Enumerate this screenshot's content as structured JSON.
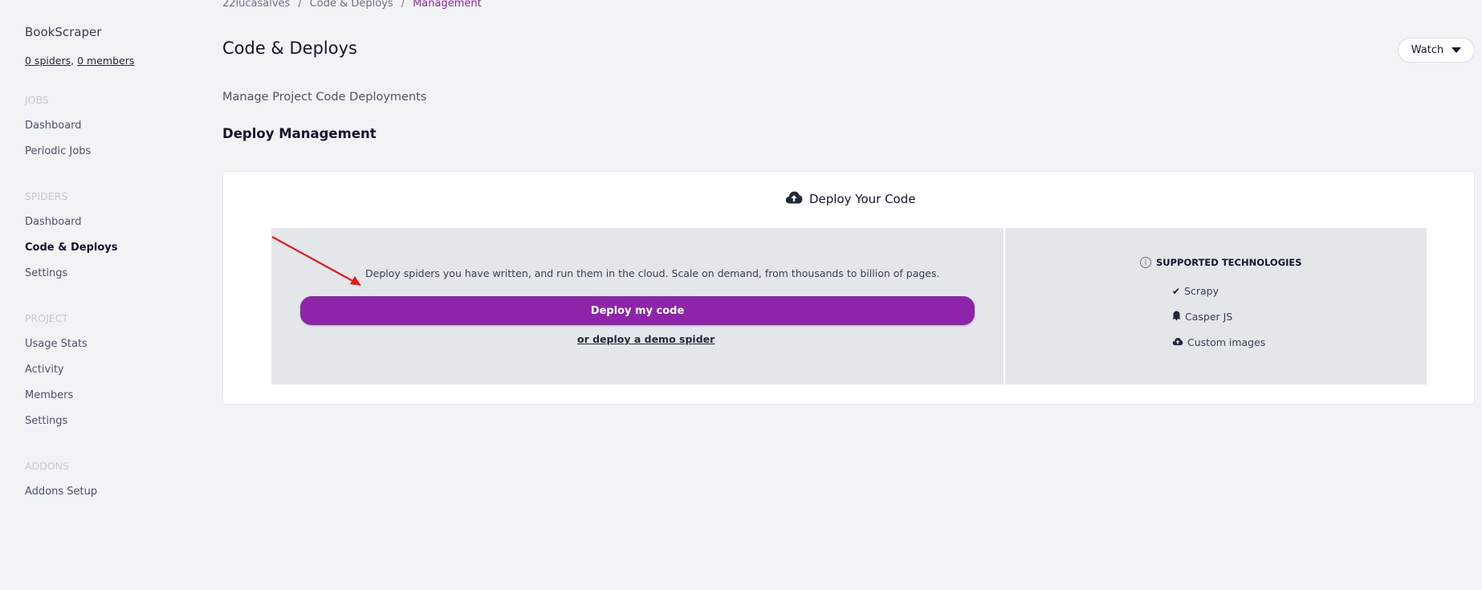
{
  "sidebar": {
    "project_name": "BookScraper",
    "spiders_link": "0 spiders",
    "separator": ",",
    "members_link": "0 members",
    "sections": {
      "jobs": {
        "title": "JOBS",
        "items": [
          "Dashboard",
          "Periodic Jobs"
        ]
      },
      "spiders": {
        "title": "SPIDERS",
        "items": [
          "Dashboard",
          "Code & Deploys",
          "Settings"
        ]
      },
      "project": {
        "title": "PROJECT",
        "items": [
          "Usage Stats",
          "Activity",
          "Members",
          "Settings"
        ]
      },
      "addons": {
        "title": "ADDONS",
        "items": [
          "Addons Setup"
        ]
      }
    }
  },
  "breadcrumb": {
    "items": [
      "22lucasalves",
      "Code & Deploys",
      "Management"
    ],
    "separator": "/"
  },
  "header": {
    "title": "Code & Deploys",
    "watch_label": "Watch"
  },
  "main": {
    "subtitle": "Manage Project Code Deployments",
    "section_heading": "Deploy Management",
    "card": {
      "title": "Deploy Your Code",
      "description": "Deploy spiders you have written, and run them in the cloud. Scale on demand, from thousands to billion of pages.",
      "deploy_button": "Deploy my code",
      "demo_link": "or deploy a demo spider",
      "tech_title": "SUPPORTED TECHNOLOGIES",
      "technologies": [
        {
          "icon": "check-icon",
          "label": "Scrapy"
        },
        {
          "icon": "ghost-icon",
          "label": "Casper JS"
        },
        {
          "icon": "cloud-upload-icon",
          "label": "Custom images"
        }
      ]
    }
  },
  "colors": {
    "accent": "#8e24aa",
    "annotation_arrow": "#e81818",
    "background": "#f2f3f5"
  }
}
